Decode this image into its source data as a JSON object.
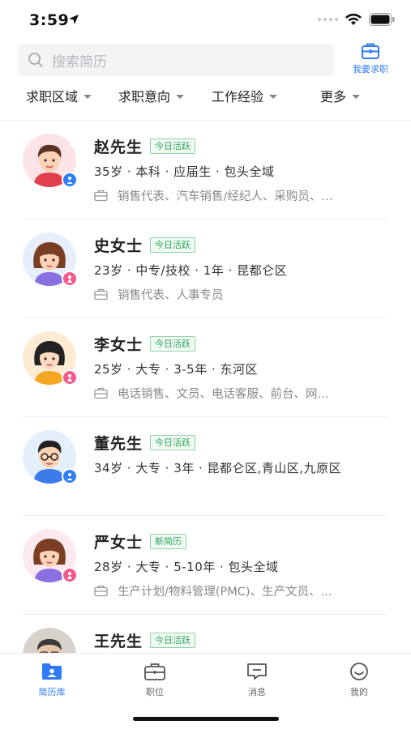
{
  "status_bar": {
    "time": "3:59"
  },
  "search": {
    "placeholder": "搜索简历"
  },
  "job_button": {
    "label": "我要求职",
    "icon": "briefcase-icon"
  },
  "filters": [
    {
      "label": "求职区域"
    },
    {
      "label": "求职意向"
    },
    {
      "label": "工作经验"
    },
    {
      "label": "更多"
    }
  ],
  "candidates": [
    {
      "name": "赵先生",
      "badge": "今日活跃",
      "info": "35岁 · 本科 · 应届生 · 包头全域",
      "intent": "销售代表、汽车销售/经纪人、采购员、...",
      "gender": "male"
    },
    {
      "name": "史女士",
      "badge": "今日活跃",
      "info": "23岁 · 中专/技校 · 1年 · 昆都仑区",
      "intent": "销售代表、人事专员",
      "gender": "female"
    },
    {
      "name": "李女士",
      "badge": "今日活跃",
      "info": "25岁 · 大专 · 3-5年 · 东河区",
      "intent": "电话销售、文员、电话客服、前台、网...",
      "gender": "female"
    },
    {
      "name": "董先生",
      "badge": "今日活跃",
      "info": "34岁 · 大专 · 3年 · 昆都仑区,青山区,九原区",
      "intent": "",
      "gender": "male"
    },
    {
      "name": "严女士",
      "badge": "新简历",
      "info": "28岁 · 大专 · 5-10年 · 包头全域",
      "intent": "生产计划/物料管理(PMC)、生产文员、...",
      "gender": "female"
    },
    {
      "name": "王先生",
      "badge": "今日活跃",
      "info": "",
      "intent": "",
      "gender": "male"
    }
  ],
  "tabbar": {
    "tabs": [
      {
        "label": "简历库",
        "icon": "resume-folder-icon",
        "active": true
      },
      {
        "label": "职位",
        "icon": "briefcase-icon",
        "active": false
      },
      {
        "label": "消息",
        "icon": "message-icon",
        "active": false
      },
      {
        "label": "我的",
        "icon": "smile-icon",
        "active": false
      }
    ]
  },
  "colors": {
    "accent": "#2f7bf5",
    "badge_green": "#2fa45a",
    "male": "#2d7ff9",
    "female": "#f25b8c"
  }
}
